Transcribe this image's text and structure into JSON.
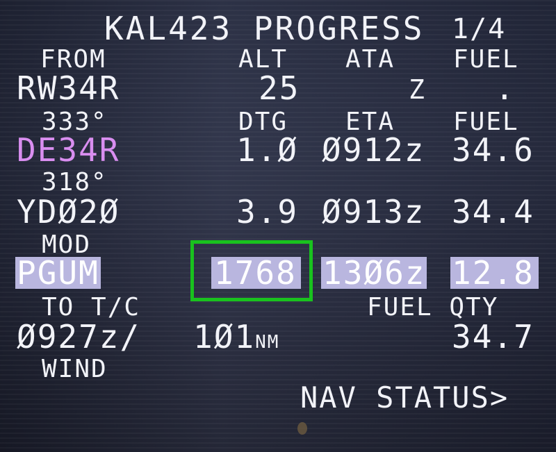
{
  "header": {
    "title": "KAL423 PROGRESS",
    "page": "1/4"
  },
  "col_headers_1": {
    "alt": "ALT",
    "ata": "ATA",
    "fuel": "FUEL"
  },
  "from": {
    "label": "FROM",
    "waypoint": "RW34R",
    "alt": "25",
    "ata": "Z",
    "fuel": "."
  },
  "col_headers_2": {
    "dtg": "DTG",
    "eta": "ETA",
    "fuel": "FUEL"
  },
  "course_1": "333°",
  "active_waypoint": {
    "name": "DE34R",
    "dtg": "1.Ø",
    "eta": "Ø912z",
    "fuel": "34.6"
  },
  "course_2": "318°",
  "next_waypoint": {
    "name": "YDØ2Ø",
    "dtg": "3.9",
    "eta": "Ø913z",
    "fuel": "34.4"
  },
  "dest": {
    "label": "MOD",
    "name": "PGUM",
    "dtg": "1768",
    "eta": "13Ø6z",
    "fuel": "12.8"
  },
  "to_tc": {
    "label": "TO T/C",
    "time": "Ø927z/",
    "dist": "1Ø1",
    "dist_unit": "NM"
  },
  "fuel_qty": {
    "label": "FUEL QTY",
    "value": "34.7"
  },
  "wind": {
    "label": "WIND"
  },
  "nav_status": {
    "label": "NAV STATUS>"
  },
  "colors": {
    "text": "#f2f3f8",
    "magenta": "#d98ef0",
    "highlight": "#b9b6df",
    "annotation_box": "#19c21e"
  }
}
